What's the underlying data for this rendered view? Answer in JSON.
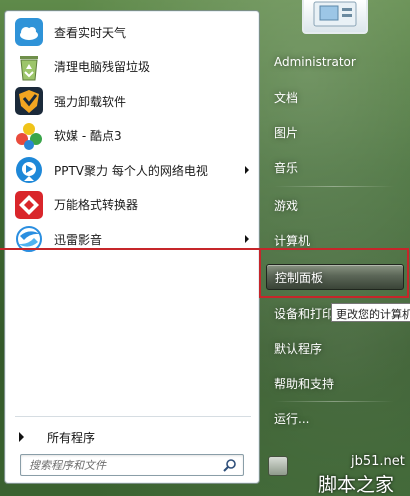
{
  "programs": [
    {
      "label": "查看实时天气",
      "icon": "weather-icon",
      "has_submenu": false
    },
    {
      "label": "清理电脑残留垃圾",
      "icon": "recycle-bin-icon",
      "has_submenu": false
    },
    {
      "label": "强力卸载软件",
      "icon": "uninstall-shield-icon",
      "has_submenu": false
    },
    {
      "label": "软媒 - 酷点3",
      "icon": "kudian-icon",
      "has_submenu": false
    },
    {
      "label": "PPTV聚力 每个人的网络电视",
      "icon": "pptv-icon",
      "has_submenu": true
    },
    {
      "label": "万能格式转换器",
      "icon": "format-converter-icon",
      "has_submenu": false
    },
    {
      "label": "迅雷影音",
      "icon": "xunlei-player-icon",
      "has_submenu": true
    }
  ],
  "all_programs_label": "所有程序",
  "search": {
    "placeholder": "搜索程序和文件"
  },
  "right_links": [
    {
      "label": "Administrator"
    },
    {
      "label": "文档"
    },
    {
      "label": "图片"
    },
    {
      "label": "音乐"
    },
    {
      "label": "游戏"
    },
    {
      "label": "计算机"
    },
    {
      "label": "控制面板"
    },
    {
      "label": "设备和打印机"
    },
    {
      "label": "默认程序"
    },
    {
      "label": "帮助和支持"
    },
    {
      "label": "运行..."
    }
  ],
  "tooltip": "更改您的计算机",
  "watermark": {
    "url": "jb51.net",
    "name": "脚本之家"
  },
  "colors": {
    "highlight_border": "#c6262a",
    "panel_bg": "#ffffff",
    "glass": "#3f6a32"
  }
}
